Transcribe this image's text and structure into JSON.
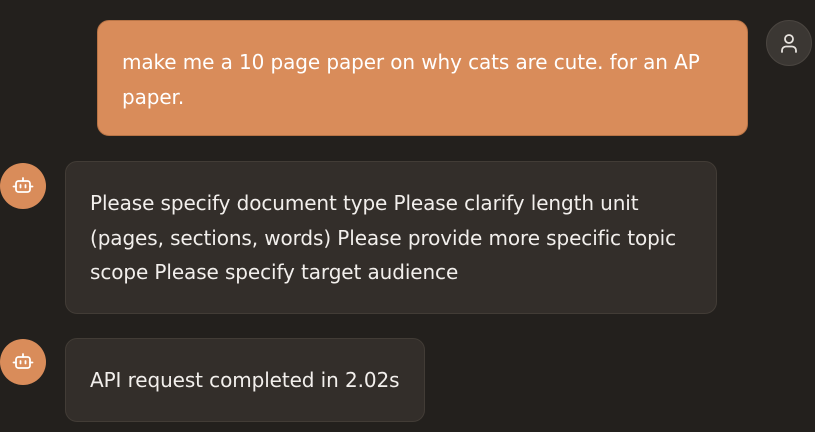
{
  "messages": {
    "user": {
      "text": "make me a 10 page paper on why cats are cute. for an AP paper.",
      "avatar_icon": "person-icon"
    },
    "bot_1": {
      "text": "Please specify document type Please clarify length unit (pages, sections, words) Please provide more specific topic scope Please specify target audience",
      "avatar_icon": "robot-icon"
    },
    "bot_2": {
      "text": "API request completed in 2.02s",
      "avatar_icon": "robot-icon"
    }
  },
  "colors": {
    "background": "#23201d",
    "accent": "#d98c5a",
    "bot_bubble": "#332e2a",
    "text_light": "#f2efec"
  }
}
